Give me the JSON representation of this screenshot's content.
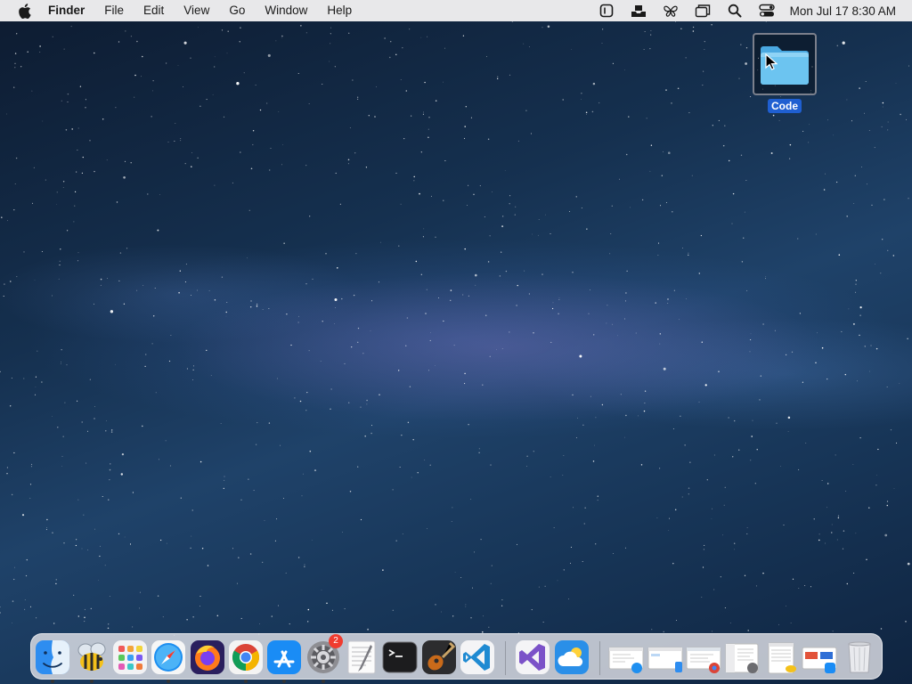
{
  "menubar": {
    "app_name": "Finder",
    "menus": [
      "File",
      "Edit",
      "View",
      "Go",
      "Window",
      "Help"
    ],
    "status_icons": [
      "screen-record-icon",
      "inbox-tray-icon",
      "butterfly-app-icon",
      "window-manager-icon",
      "spotlight-search-icon",
      "control-center-icon"
    ],
    "clock": "Mon Jul 17  8:30 AM"
  },
  "desktop": {
    "wallpaper": "starry-milky-way",
    "icons": [
      {
        "label": "Code",
        "type": "folder",
        "selected": true
      }
    ]
  },
  "dock": {
    "apps": [
      {
        "name": "Finder",
        "icon": "finder-icon",
        "running": true
      },
      {
        "name": "Cyberduck",
        "icon": "bee-icon",
        "running": true
      },
      {
        "name": "Launchpad",
        "icon": "launchpad-icon",
        "running": false
      },
      {
        "name": "Safari",
        "icon": "safari-compass-icon",
        "running": true
      },
      {
        "name": "Firefox",
        "icon": "firefox-icon",
        "running": false
      },
      {
        "name": "Google Chrome",
        "icon": "chrome-icon",
        "running": true
      },
      {
        "name": "App Store",
        "icon": "app-store-icon",
        "running": true
      },
      {
        "name": "System Settings",
        "icon": "gear-icon",
        "running": true,
        "badge": "2"
      },
      {
        "name": "TextEdit",
        "icon": "notepad-icon",
        "running": false
      },
      {
        "name": "Terminal",
        "icon": "terminal-icon",
        "running": false
      },
      {
        "name": "Instruments",
        "icon": "guitar-icon",
        "running": false
      },
      {
        "name": "Visual Studio Code",
        "icon": "vscode-icon",
        "running": false
      }
    ],
    "recent_apps": [
      {
        "name": "Visual Studio",
        "icon": "visual-studio-icon"
      },
      {
        "name": "Weather",
        "icon": "weather-cloud-icon"
      }
    ],
    "minimized_windows": [
      {
        "name": "Safari window",
        "icon": "safari-window-thumbnail"
      },
      {
        "name": "Finder window",
        "icon": "finder-window-thumbnail"
      },
      {
        "name": "Chrome window",
        "icon": "chrome-window-thumbnail"
      },
      {
        "name": "Settings window",
        "icon": "settings-window-thumbnail"
      },
      {
        "name": "Cyberduck window",
        "icon": "cyberduck-window-thumbnail"
      },
      {
        "name": "App Store window",
        "icon": "appstore-window-thumbnail"
      }
    ],
    "trash": {
      "name": "Trash",
      "icon": "trash-icon"
    }
  },
  "colors": {
    "menubar_bg": "#e8e8ea",
    "selection_blue": "#1f5fd1",
    "folder_blue": "#6cc4f0",
    "badge_red": "#f03b2f"
  }
}
